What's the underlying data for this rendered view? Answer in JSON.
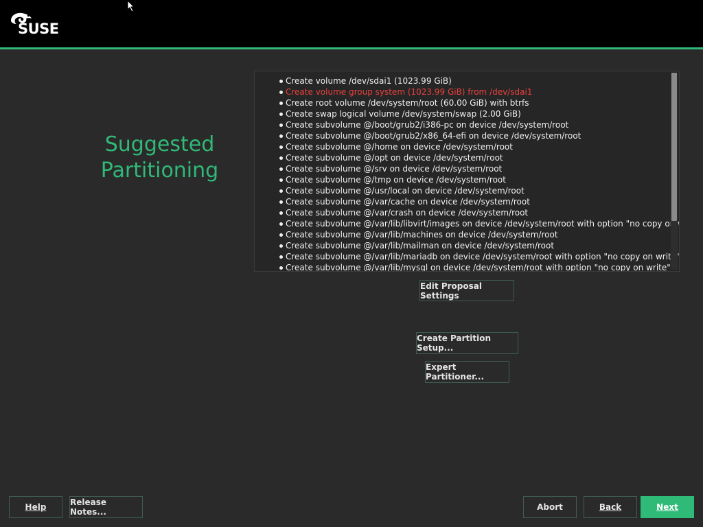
{
  "header": {
    "logo_text": "SUSE",
    "accent_color": "#30ba78"
  },
  "page": {
    "title": "Suggested Partitioning"
  },
  "summary": {
    "items": [
      {
        "text": "Create volume /dev/sdai1 (1023.99 GiB)",
        "warning": false
      },
      {
        "text": "Create volume group system (1023.99 GiB) from /dev/sdai1",
        "warning": true
      },
      {
        "text": "Create root volume /dev/system/root (60.00 GiB) with btrfs",
        "warning": false
      },
      {
        "text": "Create swap logical volume /dev/system/swap (2.00 GiB)",
        "warning": false
      },
      {
        "text": "Create subvolume @/boot/grub2/i386-pc on device /dev/system/root",
        "warning": false
      },
      {
        "text": "Create subvolume @/boot/grub2/x86_64-efi on device /dev/system/root",
        "warning": false
      },
      {
        "text": "Create subvolume @/home on device /dev/system/root",
        "warning": false
      },
      {
        "text": "Create subvolume @/opt on device /dev/system/root",
        "warning": false
      },
      {
        "text": "Create subvolume @/srv on device /dev/system/root",
        "warning": false
      },
      {
        "text": "Create subvolume @/tmp on device /dev/system/root",
        "warning": false
      },
      {
        "text": "Create subvolume @/usr/local on device /dev/system/root",
        "warning": false
      },
      {
        "text": "Create subvolume @/var/cache on device /dev/system/root",
        "warning": false
      },
      {
        "text": "Create subvolume @/var/crash on device /dev/system/root",
        "warning": false
      },
      {
        "text": "Create subvolume @/var/lib/libvirt/images on device /dev/system/root with option \"no copy on write\"",
        "warning": false
      },
      {
        "text": "Create subvolume @/var/lib/machines on device /dev/system/root",
        "warning": false
      },
      {
        "text": "Create subvolume @/var/lib/mailman on device /dev/system/root",
        "warning": false
      },
      {
        "text": "Create subvolume @/var/lib/mariadb on device /dev/system/root with option \"no copy on write\"",
        "warning": false
      },
      {
        "text": "Create subvolume @/var/lib/mysql on device /dev/system/root with option \"no copy on write\"",
        "warning": false
      }
    ],
    "warning_color": "#e8413c"
  },
  "buttons": {
    "edit_proposal": "Edit Proposal Settings",
    "create_partition": "Create Partition Setup...",
    "expert_partitioner": "Expert Partitioner...",
    "help": "Help",
    "release_notes": "Release Notes...",
    "abort": "Abort",
    "back": "Back",
    "next": "Next"
  }
}
